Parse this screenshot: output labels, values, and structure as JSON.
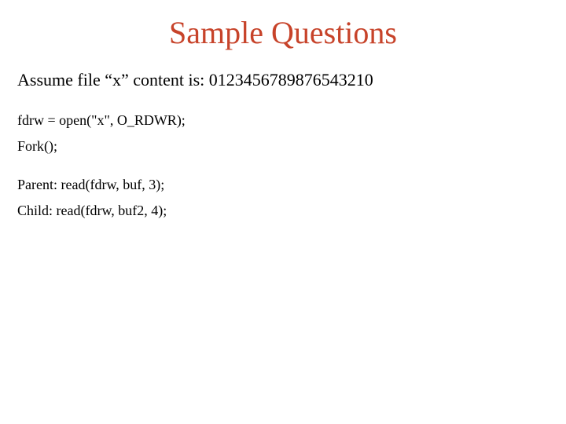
{
  "title": "Sample Questions",
  "assume": "Assume file “x” content is: 0123456789876543210",
  "code": {
    "line1": "fdrw = open(\"x\", O_RDWR);",
    "line2": "Fork();",
    "line3": "Parent: read(fdrw, buf, 3);",
    "line4": "Child: read(fdrw, buf2, 4);"
  }
}
